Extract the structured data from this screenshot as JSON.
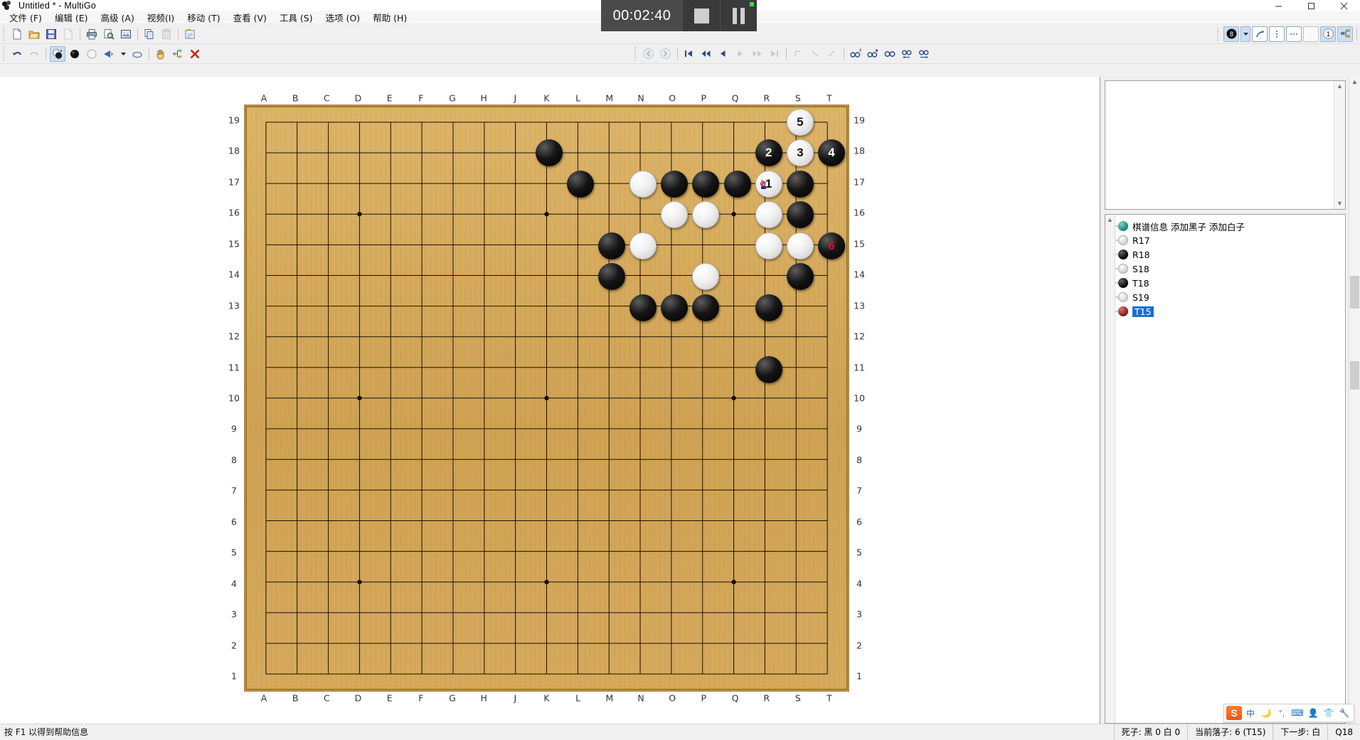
{
  "window": {
    "title": "Untitled  * - MultiGo",
    "app_icon": "go-stones-icon",
    "buttons": {
      "minimize": "minimize-icon",
      "maximize": "maximize-icon",
      "close": "close-icon"
    }
  },
  "menu": {
    "items": [
      {
        "label": "文件 (F)"
      },
      {
        "label": "编辑 (E)"
      },
      {
        "label": "高级 (A)"
      },
      {
        "label": "视频(I)"
      },
      {
        "label": "移动 (T)"
      },
      {
        "label": "查看 (V)"
      },
      {
        "label": "工具 (S)"
      },
      {
        "label": "选项 (O)"
      },
      {
        "label": "帮助 (H)"
      }
    ]
  },
  "timer": {
    "time": "00:02:40",
    "stop_label": "stop-icon",
    "pause_label": "pause-icon",
    "recording_indicator": "green-dot"
  },
  "toolbar_main": {
    "icons": [
      "new-file-icon",
      "open-folder-icon",
      "save-icon",
      "save-as-icon",
      "print-icon",
      "print-preview-icon",
      "export-image-icon",
      "copy-icon",
      "paste-icon",
      "game-info-icon"
    ],
    "right_icons": [
      "black-stone-number-icon",
      "dropdown-arrow-icon",
      "move-arrow-icon",
      "column-marks-icon",
      "dotted-marks-icon",
      "blank-mark-icon",
      "number-one-icon",
      "branch-icon",
      "sgf-icon"
    ],
    "black_badge": "8",
    "one_badge": "1"
  },
  "toolbar_edit": {
    "icons": [
      "undo-icon",
      "redo-icon",
      "alternate-stone-icon",
      "black-stone-icon",
      "white-stone-icon",
      "marker-icon",
      "dropdown-arrow-icon",
      "eraser-icon",
      "hand-icon",
      "tree-icon",
      "delete-icon"
    ],
    "nav_icons": [
      "back-circle-icon",
      "forward-circle-icon",
      "first-move-icon",
      "rewind-icon",
      "prev-move-icon",
      "next-move-icon",
      "fast-forward-icon",
      "last-move-icon",
      "branch-up-icon",
      "branch-left-icon",
      "branch-right-icon",
      "find-hash-icon",
      "find-dot-icon",
      "find-icon",
      "find-prev-icon",
      "find-next-icon"
    ]
  },
  "board": {
    "size": 19,
    "col_labels": [
      "A",
      "B",
      "C",
      "D",
      "E",
      "F",
      "G",
      "H",
      "J",
      "K",
      "L",
      "M",
      "N",
      "O",
      "P",
      "Q",
      "R",
      "S",
      "T"
    ],
    "row_labels": [
      "19",
      "18",
      "17",
      "16",
      "15",
      "14",
      "13",
      "12",
      "11",
      "10",
      "9",
      "8",
      "7",
      "6",
      "5",
      "4",
      "3",
      "2",
      "1"
    ],
    "star_points": [
      [
        "D",
        4
      ],
      [
        "K",
        4
      ],
      [
        "Q",
        4
      ],
      [
        "D",
        10
      ],
      [
        "K",
        10
      ],
      [
        "Q",
        10
      ],
      [
        "D",
        16
      ],
      [
        "K",
        16
      ],
      [
        "Q",
        16
      ]
    ],
    "stones": [
      {
        "color": "black",
        "col": "K",
        "row": 18
      },
      {
        "color": "black",
        "col": "L",
        "row": 17
      },
      {
        "color": "white",
        "col": "N",
        "row": 17
      },
      {
        "color": "black",
        "col": "O",
        "row": 17
      },
      {
        "color": "black",
        "col": "P",
        "row": 17
      },
      {
        "color": "black",
        "col": "Q",
        "row": 17
      },
      {
        "color": "white",
        "col": "R",
        "row": 17,
        "number": "1"
      },
      {
        "color": "black",
        "col": "S",
        "row": 17
      },
      {
        "color": "white",
        "col": "O",
        "row": 16
      },
      {
        "color": "white",
        "col": "P",
        "row": 16
      },
      {
        "color": "white",
        "col": "R",
        "row": 16
      },
      {
        "color": "black",
        "col": "S",
        "row": 16
      },
      {
        "color": "black",
        "col": "M",
        "row": 15
      },
      {
        "color": "white",
        "col": "N",
        "row": 15
      },
      {
        "color": "white",
        "col": "R",
        "row": 15
      },
      {
        "color": "white",
        "col": "S",
        "row": 15
      },
      {
        "color": "black",
        "col": "T",
        "row": 15,
        "number": "6",
        "number_color": "red"
      },
      {
        "color": "black",
        "col": "M",
        "row": 14
      },
      {
        "color": "white",
        "col": "P",
        "row": 14
      },
      {
        "color": "black",
        "col": "S",
        "row": 14
      },
      {
        "color": "black",
        "col": "N",
        "row": 13
      },
      {
        "color": "black",
        "col": "O",
        "row": 13
      },
      {
        "color": "black",
        "col": "P",
        "row": 13
      },
      {
        "color": "black",
        "col": "R",
        "row": 13
      },
      {
        "color": "black",
        "col": "R",
        "row": 11
      },
      {
        "color": "white",
        "col": "S",
        "row": 19,
        "number": "5"
      },
      {
        "color": "black",
        "col": "R",
        "row": 18,
        "number": "2"
      },
      {
        "color": "white",
        "col": "S",
        "row": 18,
        "number": "3"
      },
      {
        "color": "black",
        "col": "T",
        "row": 18,
        "number": "4"
      }
    ],
    "cursor": {
      "col": "R",
      "row": 17,
      "icon": "no-drop-cursor"
    }
  },
  "game_tree": {
    "root_label": "棋谱信息 添加黑子 添加白子",
    "nodes": [
      {
        "label": "R17",
        "color": "white"
      },
      {
        "label": "R18",
        "color": "black"
      },
      {
        "label": "S18",
        "color": "white"
      },
      {
        "label": "T18",
        "color": "black"
      },
      {
        "label": "S19",
        "color": "white"
      },
      {
        "label": "T15",
        "color": "black",
        "selected": true
      }
    ]
  },
  "comment_panel": {
    "text": ""
  },
  "ime": {
    "logo": "S",
    "items": [
      "中",
      "moon-icon",
      "degree-comma-icon",
      "keyboard-icon",
      "user-box-icon",
      "shirt-icon",
      "wrench-icon"
    ]
  },
  "statusbar": {
    "hint": "按 F1 以得到帮助信息",
    "captures": "死子: 黑 0 白 0",
    "current_move": "当前落子: 6 (T15)",
    "next_move": "下一步: 白",
    "coordinate": "Q18"
  }
}
